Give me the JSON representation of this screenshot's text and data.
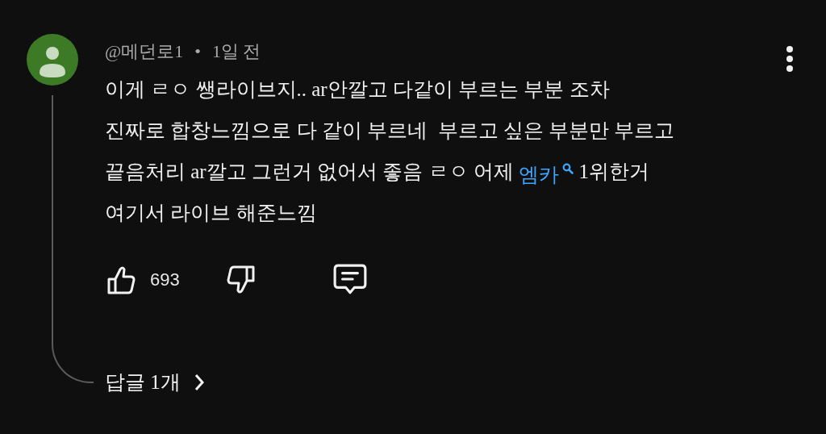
{
  "comment": {
    "author": "@메던로1",
    "separator": "•",
    "time": "1일 전",
    "body_lines": [
      [
        {
          "kind": "text",
          "text": "이게 ㄹㅇ 쌩라이브지.. ar안깔고 다같이 부르는 부분 조차"
        }
      ],
      [
        {
          "kind": "text",
          "text": "진짜로 합창느낌으로 다 같이 부르네  부르고 싶은 부분만 부르고"
        }
      ],
      [
        {
          "kind": "text",
          "text": "끝음처리 ar깔고 그런거 없어서 좋음 ㄹㅇ 어제 "
        },
        {
          "kind": "search_link",
          "text": "엠카"
        },
        {
          "kind": "text",
          "text": " 1위한거"
        }
      ],
      [
        {
          "kind": "text",
          "text": "여기서 라이브 해준느낌"
        }
      ]
    ],
    "like_count": "693",
    "replies": "답글 1개"
  }
}
